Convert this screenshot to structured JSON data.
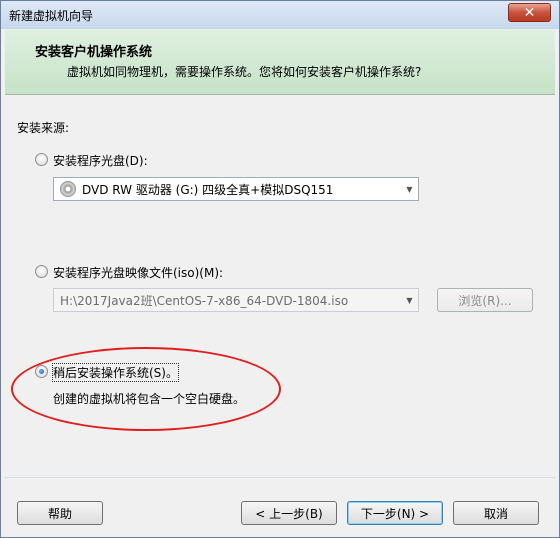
{
  "window": {
    "title": "新建虚拟机向导",
    "close_label": "✕"
  },
  "header": {
    "title": "安装客户机操作系统",
    "description": "虚拟机如同物理机，需要操作系统。您将如何安装客户机操作系统?"
  },
  "source_label": "安装来源:",
  "options": {
    "disc": {
      "label": "安装程序光盘(D):",
      "checked": false,
      "combo_value": "DVD RW 驱动器 (G:) 四级全真+模拟DSQ151"
    },
    "iso": {
      "label": "安装程序光盘映像文件(iso)(M):",
      "checked": false,
      "combo_value": "H:\\2017Java2班\\CentOS-7-x86_64-DVD-1804.iso",
      "browse_label": "浏览(R)..."
    },
    "later": {
      "label": "稍后安装操作系统(S)。",
      "checked": true,
      "description": "创建的虚拟机将包含一个空白硬盘。"
    }
  },
  "footer": {
    "help": "帮助",
    "back": "< 上一步(B)",
    "next": "下一步(N) >",
    "cancel": "取消"
  },
  "colors": {
    "header_bg": "#c6e2c7",
    "annotation": "#e02020"
  }
}
